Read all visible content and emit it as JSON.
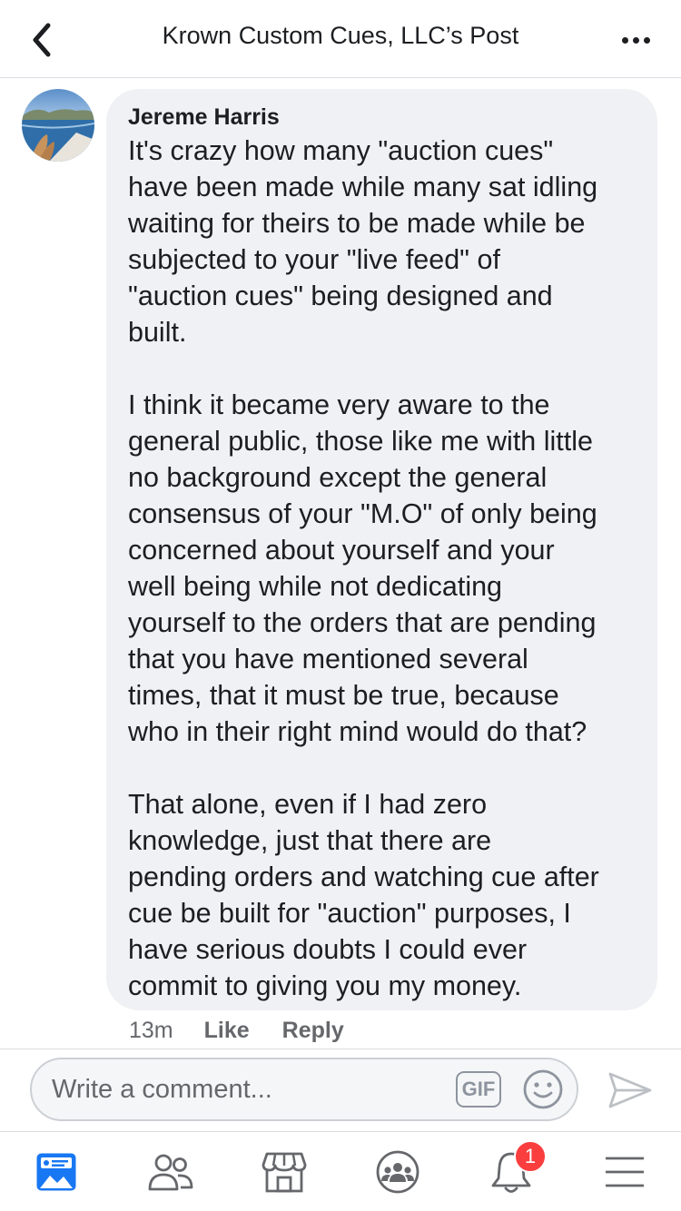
{
  "header": {
    "title": "Krown Custom Cues, LLC’s Post",
    "back_icon": "chevron-left-icon",
    "more_icon": "more-horizontal-icon"
  },
  "comment": {
    "author": "Jereme Harris",
    "paragraphs": [
      [
        "It's crazy how many \"auction cues\"",
        "have been made while many sat idling",
        "waiting for theirs to be made while be",
        "subjected to your \"live feed\" of",
        "\"auction cues\" being designed and",
        "built."
      ],
      [
        "I think it became very aware to the",
        "general public, those like me with little",
        "no background except the general",
        "consensus of your \"M.O\" of only being",
        "concerned about yourself and your",
        "well being while not dedicating",
        "yourself to the orders that are pending",
        "that you have mentioned several",
        "times, that it must be true,  because",
        "who in their right mind would do that?"
      ],
      [
        "That alone,  even if I had zero",
        "knowledge,  just that there are",
        "pending orders and watching cue after",
        "cue be built for \"auction\" purposes, I",
        "have serious doubts I could ever",
        "commit to giving you my money."
      ]
    ],
    "time": "13m",
    "like_label": "Like",
    "reply_label": "Reply"
  },
  "composer": {
    "placeholder": "Write a comment...",
    "gif_label": "GIF"
  },
  "tabbar": {
    "notifications_badge": "1",
    "icons": [
      "news-feed-icon",
      "friends-icon",
      "marketplace-icon",
      "groups-icon",
      "notifications-icon",
      "menu-icon"
    ]
  },
  "colors": {
    "accent": "#1877f2",
    "badge": "#fa3e3e",
    "bubble": "#f0f1f4",
    "secondary_text": "#65676b"
  }
}
